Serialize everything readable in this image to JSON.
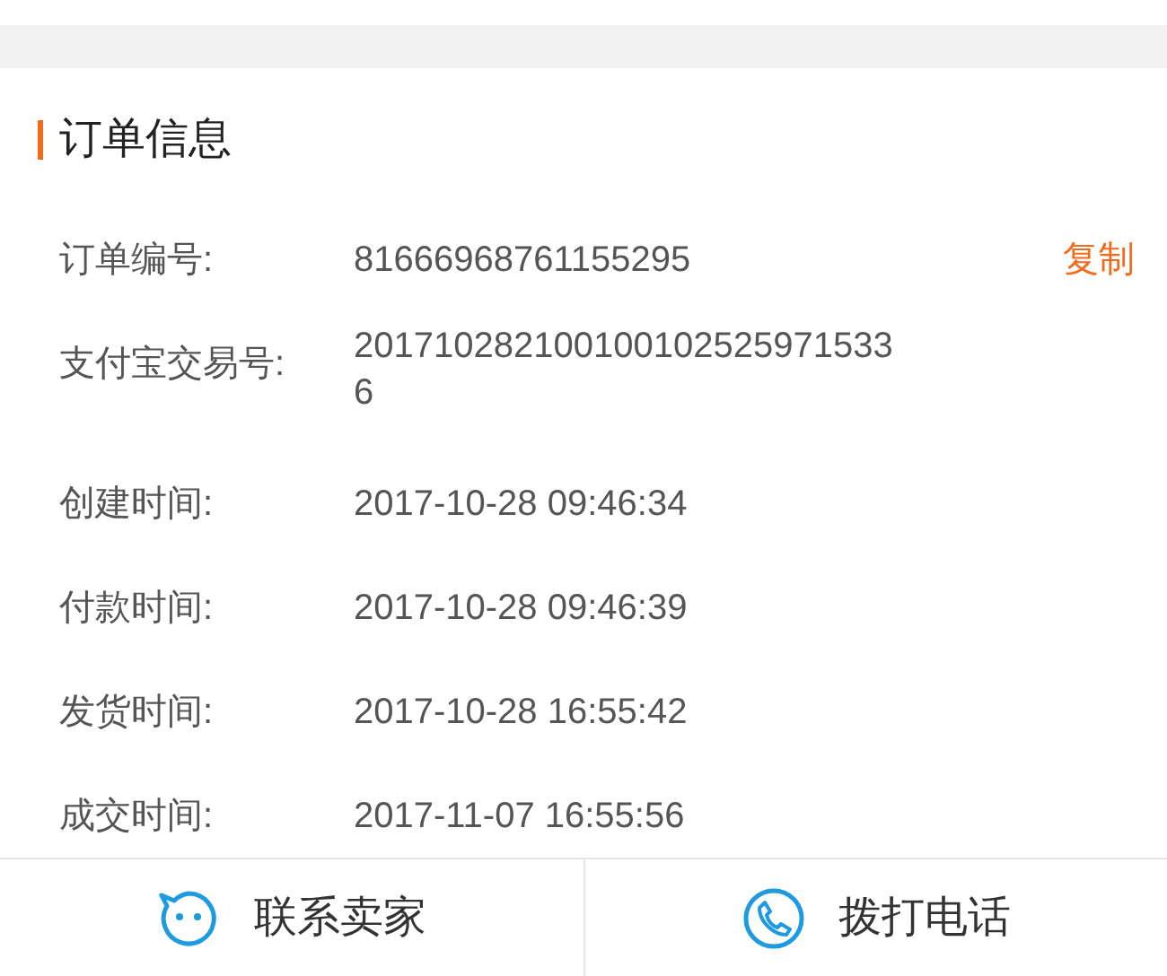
{
  "section": {
    "title": "订单信息"
  },
  "rows": [
    {
      "label": "订单编号:",
      "value": "81666968761155295",
      "action": "复制"
    },
    {
      "label": "支付宝交易号:",
      "value": "2017102821001001025259715336"
    },
    {
      "label": "创建时间:",
      "value": "2017-10-28 09:46:34"
    },
    {
      "label": "付款时间:",
      "value": "2017-10-28 09:46:39"
    },
    {
      "label": "发货时间:",
      "value": "2017-10-28 16:55:42"
    },
    {
      "label": "成交时间:",
      "value": "2017-11-07 16:55:56"
    }
  ],
  "bottom_bar": [
    {
      "kind": "chat",
      "label": "联系卖家"
    },
    {
      "kind": "phone",
      "label": "拨打电话"
    }
  ]
}
